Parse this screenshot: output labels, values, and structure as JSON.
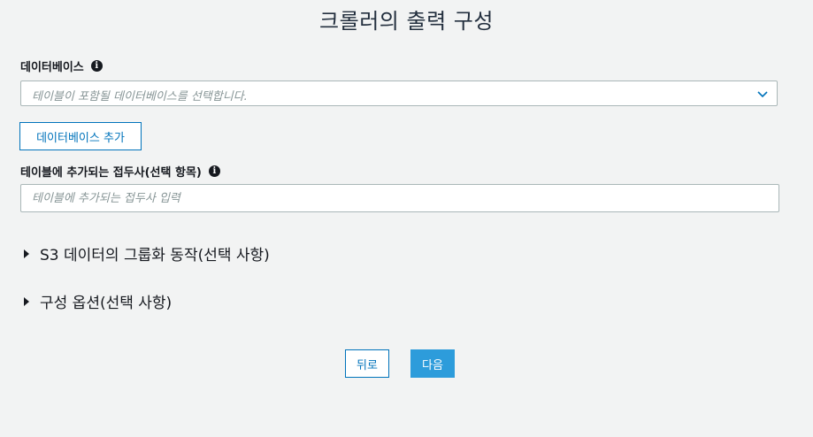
{
  "page": {
    "title": "크롤러의 출력 구성"
  },
  "database": {
    "label": "데이터베이스",
    "placeholder": "테이블이 포함될 데이터베이스를 선택합니다.",
    "add_button": "데이터베이스 추가"
  },
  "prefix": {
    "label": "테이블에 추가되는 접두사(선택 항목)",
    "placeholder": "테이블에 추가되는 접두사 입력"
  },
  "sections": {
    "s3_grouping": "S3 데이터의 그룹화 동작(선택 사항)",
    "config_options": "구성 옵션(선택 사항)"
  },
  "footer": {
    "back_label": "뒤로",
    "next_label": "다음"
  },
  "colors": {
    "accent": "#0073bb",
    "primary_button": "#2d9cdb",
    "background": "#f2f3f3"
  },
  "icons": {
    "info": "info-icon",
    "dropdown": "chevron-down-icon",
    "expand": "caret-right-icon"
  }
}
